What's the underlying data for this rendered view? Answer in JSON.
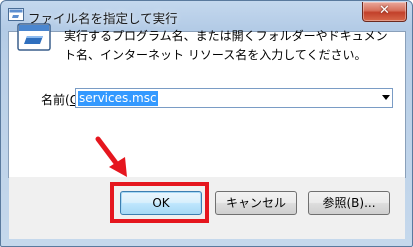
{
  "window": {
    "title": "ファイル名を指定して実行",
    "close_label": "✕"
  },
  "dialog": {
    "description": "実行するプログラム名、または開くフォルダーやドキュメント名、インターネット リソース名を入力してください。",
    "field_label_prefix": "名前(",
    "field_label_key": "O",
    "field_label_suffix": "):",
    "command_value": "services.msc"
  },
  "buttons": {
    "ok": "OK",
    "cancel": "キャンセル",
    "browse": "参照(B)..."
  },
  "annotation": {
    "highlight_color": "#e5161e"
  },
  "icons": {
    "app": "run-dialog-icon",
    "run": "run-program-icon",
    "close": "close-icon",
    "dropdown": "chevron-down-icon",
    "pointer": "red-arrow-icon"
  }
}
